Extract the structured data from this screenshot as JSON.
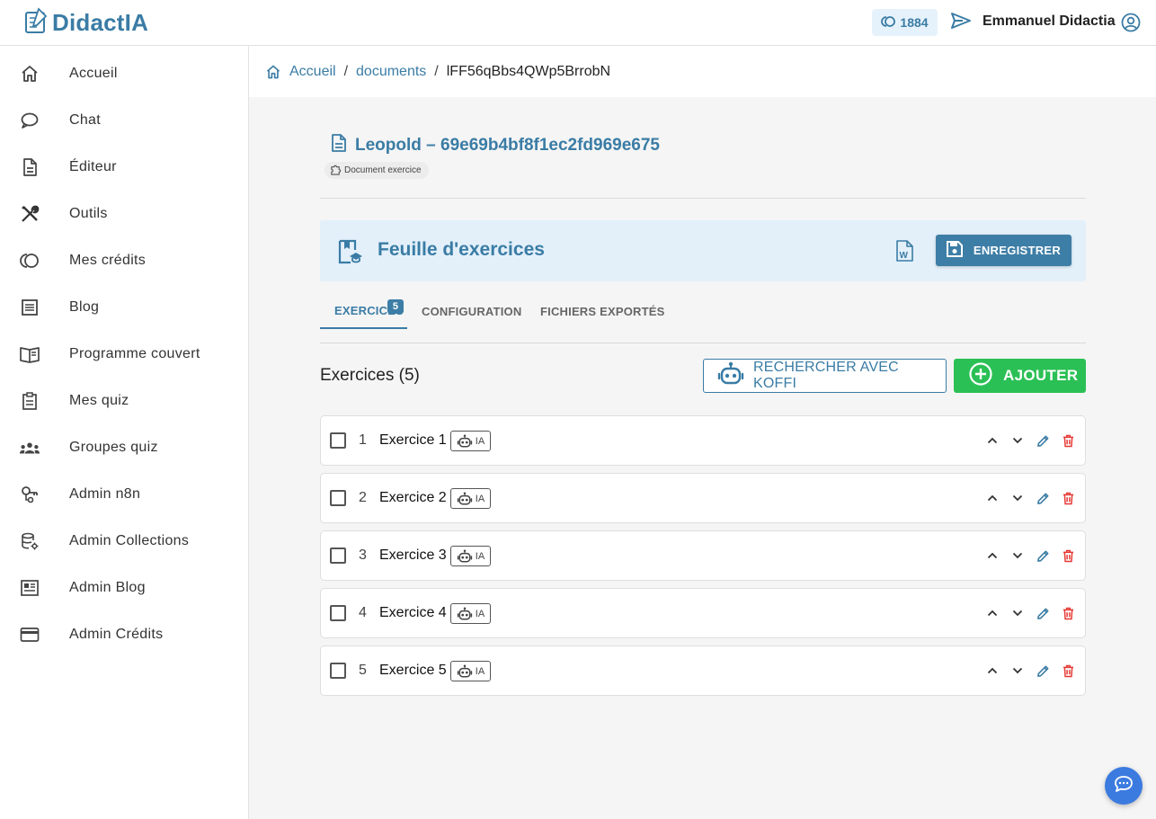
{
  "app": {
    "brand": "DidactIA",
    "credits": "1884",
    "user_name": "Emmanuel Didactia"
  },
  "sidebar": {
    "items": [
      {
        "label": "Accueil",
        "icon": "home-icon"
      },
      {
        "label": "Chat",
        "icon": "chat-icon"
      },
      {
        "label": "Éditeur",
        "icon": "document-icon"
      },
      {
        "label": "Outils",
        "icon": "tools-icon"
      },
      {
        "label": "Mes crédits",
        "icon": "credits-icon"
      },
      {
        "label": "Blog",
        "icon": "blog-icon"
      },
      {
        "label": "Programme couvert",
        "icon": "book-icon"
      },
      {
        "label": "Mes quiz",
        "icon": "clipboard-icon"
      },
      {
        "label": "Groupes quiz",
        "icon": "group-icon"
      },
      {
        "label": "Admin n8n",
        "icon": "key-icon"
      },
      {
        "label": "Admin Collections",
        "icon": "database-icon"
      },
      {
        "label": "Admin Blog",
        "icon": "news-icon"
      },
      {
        "label": "Admin Crédits",
        "icon": "card-icon"
      }
    ]
  },
  "breadcrumb": {
    "home": "Accueil",
    "section": "documents",
    "current": "lFF56qBbs4QWp5BrrobN"
  },
  "document": {
    "title": "Leopold – 69e69b4bf8f1ec2fd969e675",
    "type_chip": "Document exercice"
  },
  "sheet": {
    "title": "Feuille d'exercices",
    "save_label": "ENREGISTRER"
  },
  "tabs": [
    {
      "label": "EXERCICES",
      "badge": "5",
      "active": true
    },
    {
      "label": "CONFIGURATION",
      "active": false
    },
    {
      "label": "FICHIERS EXPORTÉS",
      "active": false
    }
  ],
  "exercises": {
    "heading": "Exercices (5)",
    "koffi_label": "RECHERCHER AVEC KOFFI",
    "add_label": "AJOUTER",
    "items": [
      {
        "num": "1",
        "name": "Exercice 1",
        "badge": "IA"
      },
      {
        "num": "2",
        "name": "Exercice 2",
        "badge": "IA"
      },
      {
        "num": "3",
        "name": "Exercice 3",
        "badge": "IA"
      },
      {
        "num": "4",
        "name": "Exercice 4",
        "badge": "IA"
      },
      {
        "num": "5",
        "name": "Exercice 5",
        "badge": "IA"
      }
    ]
  },
  "colors": {
    "primary": "#3a7ca5",
    "success": "#2bc055",
    "danger": "#e53935",
    "fab": "#3b7be0"
  }
}
